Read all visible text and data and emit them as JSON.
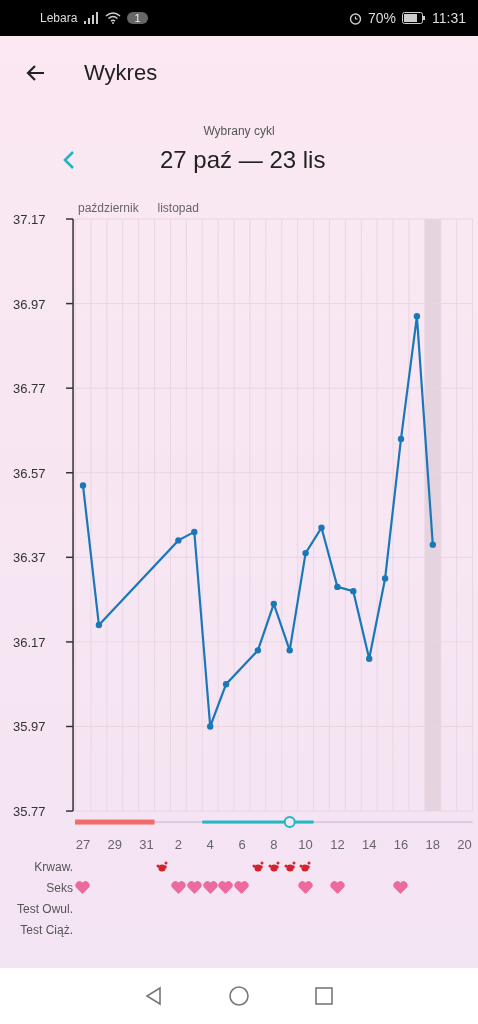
{
  "status_bar": {
    "carrier": "Lebara",
    "notification_count": "1",
    "battery": "70%",
    "time": "11:31"
  },
  "header": {
    "title": "Wykres"
  },
  "cycle": {
    "caption": "Wybrany cykl",
    "range": "27 paź — 23 lis"
  },
  "chart": {
    "chart_data": {
      "type": "line",
      "grid": true,
      "categories": [
        "27",
        null,
        "29",
        null,
        "31",
        null,
        "2",
        null,
        "4",
        null,
        "6",
        null,
        "8",
        null,
        "10",
        null,
        "12",
        null,
        "14",
        null,
        "16",
        null,
        "18",
        null,
        "20"
      ],
      "series": [
        {
          "color": "#1a78b8",
          "marker": "o",
          "values": [
            36.54,
            36.21,
            null,
            null,
            null,
            null,
            36.41,
            36.43,
            35.97,
            36.07,
            null,
            36.15,
            36.26,
            36.15,
            36.38,
            36.44,
            36.3,
            36.29,
            36.13,
            36.32,
            36.65,
            36.94,
            36.4,
            null,
            null
          ]
        }
      ],
      "ylim": [
        35.77,
        37.17
      ],
      "yticks": [
        {
          "value": 37.17,
          "label": "37.17"
        },
        {
          "value": 36.97,
          "label": "36.97"
        },
        {
          "value": 36.77,
          "label": "36.77"
        },
        {
          "value": 36.57,
          "label": "36.57"
        },
        {
          "value": 36.37,
          "label": "36.37"
        },
        {
          "value": 36.17,
          "label": "36.17"
        },
        {
          "value": 35.97,
          "label": "35.97"
        },
        {
          "value": 35.77,
          "label": "35.77"
        }
      ]
    },
    "timeline": [
      {
        "kind": "period",
        "month": "październik"
      },
      {
        "kind": "period"
      },
      {
        "kind": "period"
      },
      {
        "kind": "period"
      },
      {
        "kind": "period"
      },
      {
        "kind": "none",
        "month": "listopad"
      },
      {
        "kind": "none"
      },
      {
        "kind": "none"
      },
      {
        "kind": "fertile"
      },
      {
        "kind": "fertile"
      },
      {
        "kind": "fertile"
      },
      {
        "kind": "fertile"
      },
      {
        "kind": "fertile"
      },
      {
        "kind": "ovulation"
      },
      {
        "kind": "fertile"
      },
      {
        "kind": "none"
      },
      {
        "kind": "none"
      },
      {
        "kind": "none"
      },
      {
        "kind": "none"
      },
      {
        "kind": "none"
      },
      {
        "kind": "none"
      },
      {
        "kind": "none"
      },
      {
        "kind": "today"
      },
      {
        "kind": "none"
      },
      {
        "kind": "none"
      }
    ]
  },
  "markers": [
    {
      "label": "Krwaw.",
      "days": [
        {
          "kind": "none"
        },
        {
          "kind": "none"
        },
        {
          "kind": "none"
        },
        {
          "kind": "none"
        },
        {
          "kind": "none"
        },
        {
          "kind": "blood"
        },
        {
          "kind": "none"
        },
        {
          "kind": "none"
        },
        {
          "kind": "none"
        },
        {
          "kind": "none"
        },
        {
          "kind": "none"
        },
        {
          "kind": "blood"
        },
        {
          "kind": "blood"
        },
        {
          "kind": "blood"
        },
        {
          "kind": "blood"
        }
      ]
    },
    {
      "label": "Seks",
      "days": [
        {
          "kind": "heart"
        },
        {
          "kind": "none"
        },
        {
          "kind": "none"
        },
        {
          "kind": "none"
        },
        {
          "kind": "none"
        },
        {
          "kind": "none"
        },
        {
          "kind": "heart"
        },
        {
          "kind": "heart"
        },
        {
          "kind": "heart"
        },
        {
          "kind": "heart"
        },
        {
          "kind": "heart"
        },
        {
          "kind": "none"
        },
        {
          "kind": "none"
        },
        {
          "kind": "none"
        },
        {
          "kind": "heart"
        },
        {
          "kind": "none"
        },
        {
          "kind": "heart"
        },
        {
          "kind": "none"
        },
        {
          "kind": "none"
        },
        {
          "kind": "none"
        },
        {
          "kind": "heart"
        }
      ]
    },
    {
      "label": "Test Owul."
    },
    {
      "label": "Test Ciąż."
    }
  ]
}
